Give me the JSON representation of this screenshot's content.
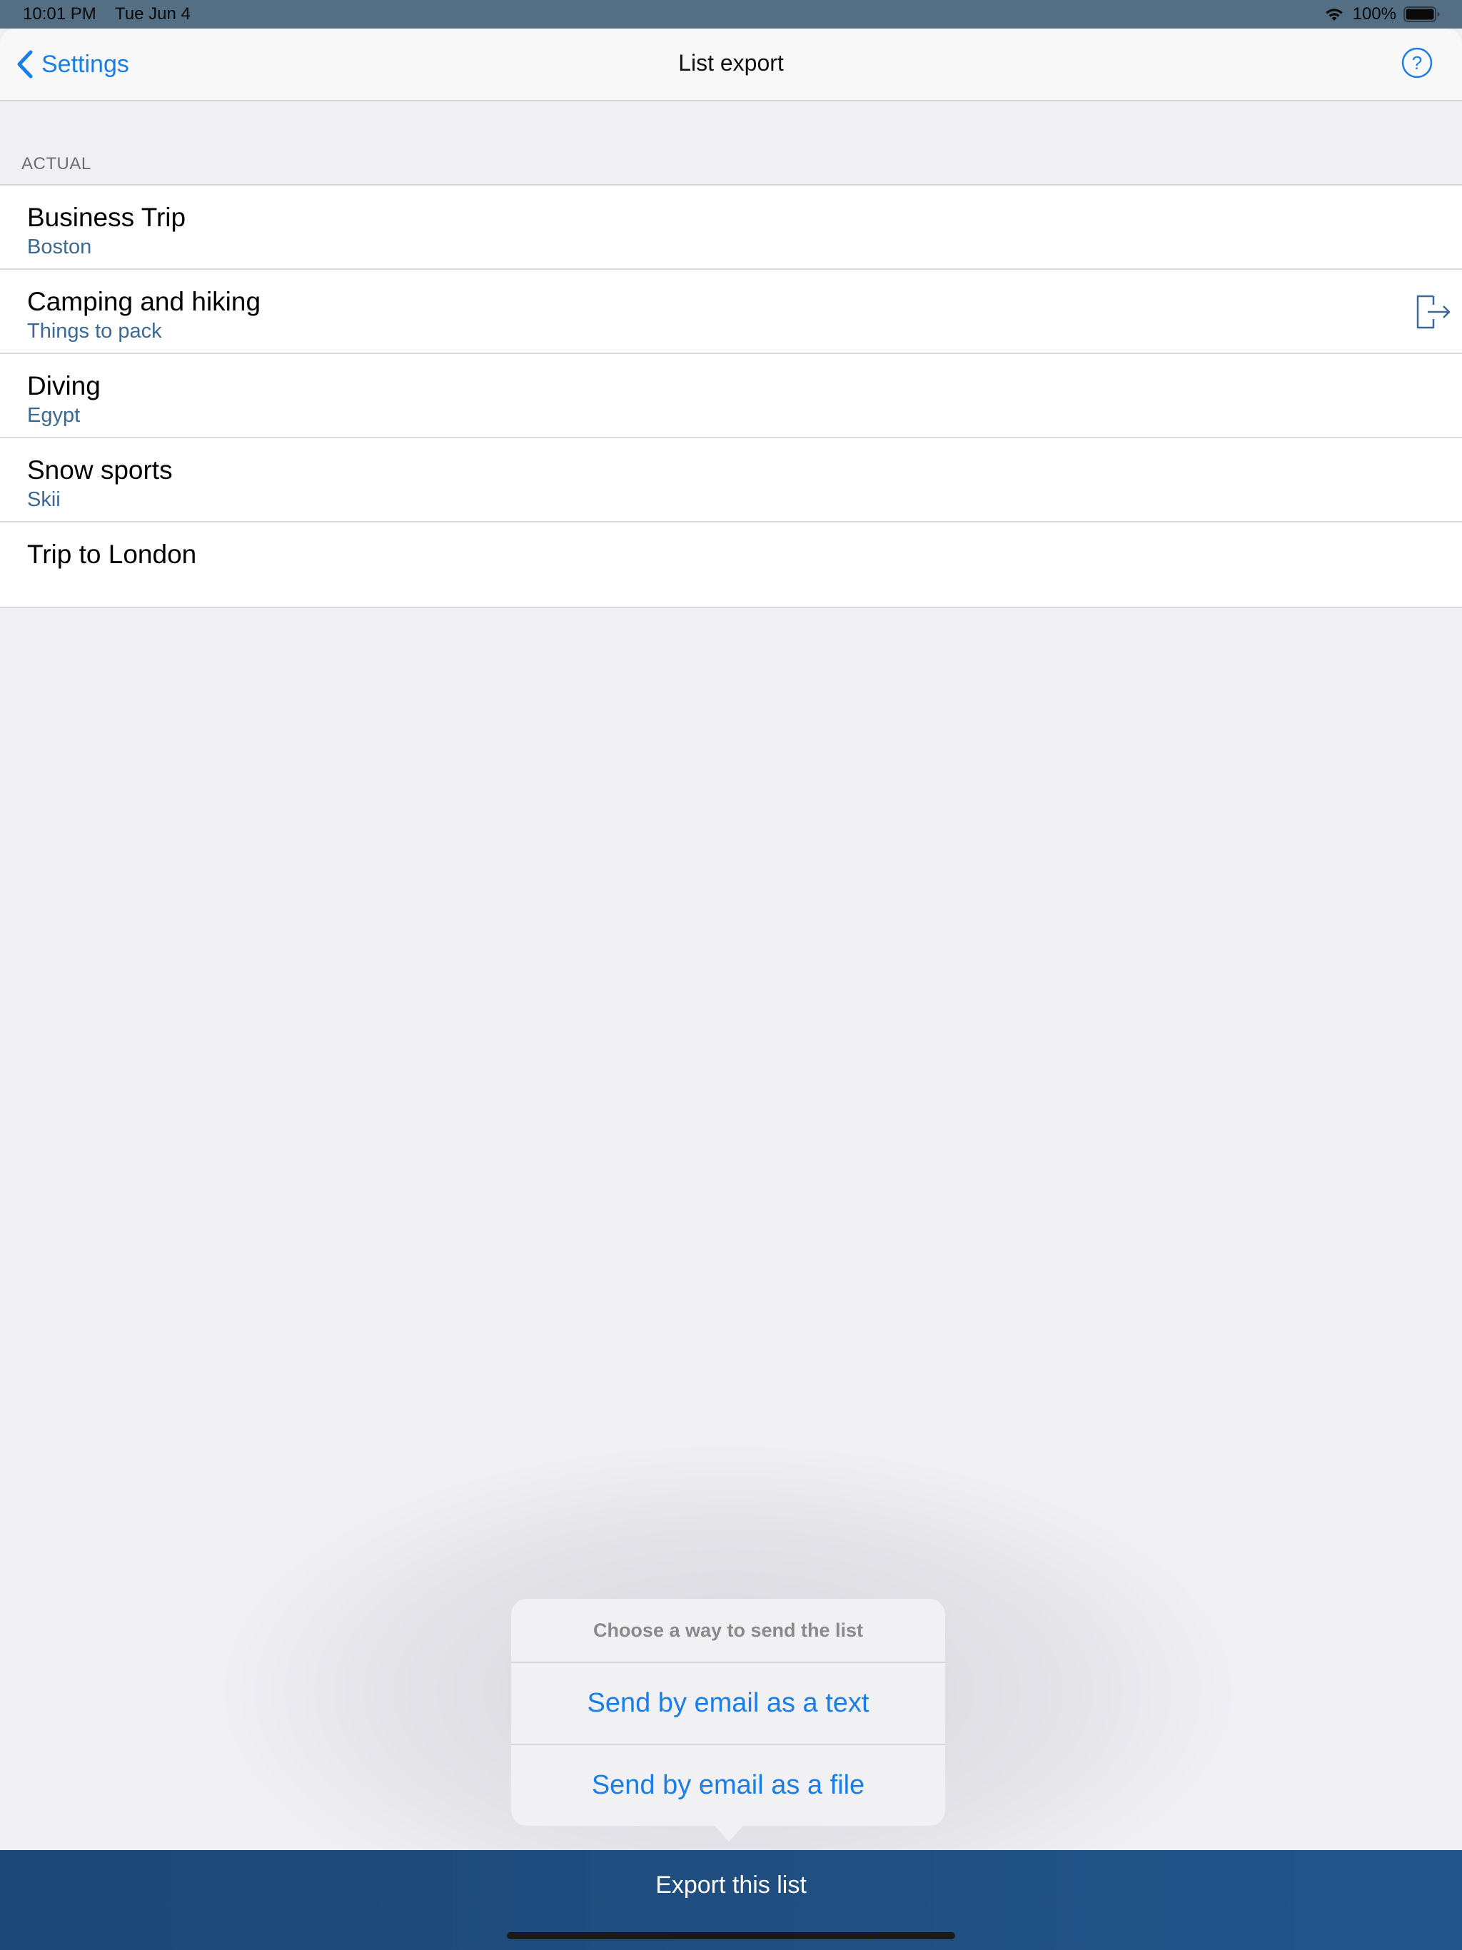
{
  "status_bar": {
    "time": "10:01 PM",
    "date": "Tue Jun 4",
    "battery": "100%"
  },
  "nav": {
    "back_label": "Settings",
    "title": "List export"
  },
  "section": {
    "header": "ACTUAL"
  },
  "lists": [
    {
      "title": "Business Trip",
      "subtitle": "Boston"
    },
    {
      "title": "Camping and hiking",
      "subtitle": "Things to pack"
    },
    {
      "title": "Diving",
      "subtitle": "Egypt"
    },
    {
      "title": "Snow sports",
      "subtitle": "Skii"
    },
    {
      "title": "Trip to London",
      "subtitle": ""
    }
  ],
  "popover": {
    "title": "Choose a way to send the list",
    "options": [
      "Send by email as a text",
      "Send by email as a file"
    ]
  },
  "bottom_bar": {
    "export_label": "Export this list"
  },
  "colors": {
    "accent": "#1a7ee6",
    "bottom_bar": "#1f4e82",
    "subtitle": "#3b6894"
  },
  "icons": [
    "wifi-icon",
    "battery-icon",
    "chevron-left-icon",
    "help-icon",
    "export-icon"
  ]
}
